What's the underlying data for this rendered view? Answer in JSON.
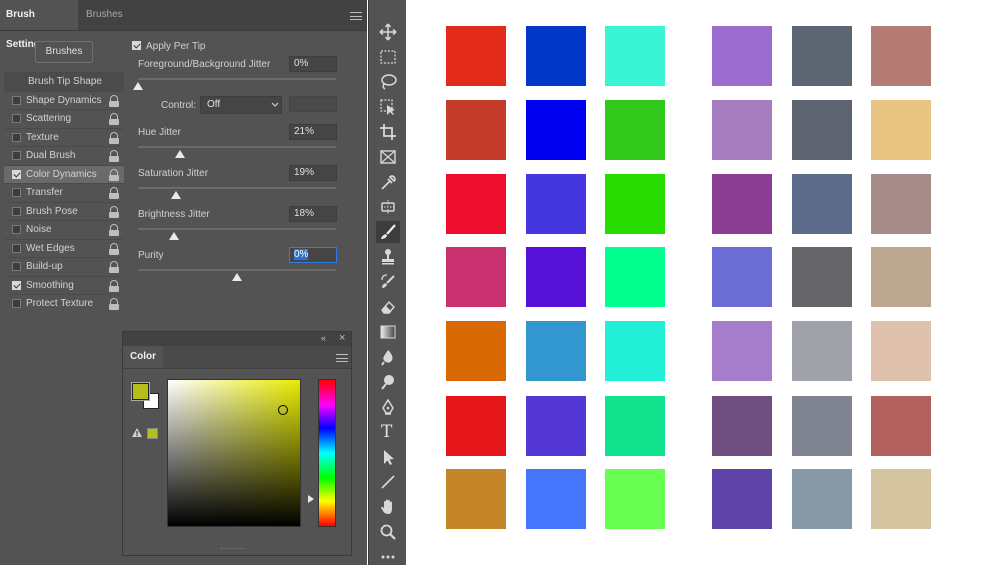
{
  "brush_settings": {
    "tabs": [
      "Brush Settings",
      "Brushes"
    ],
    "brushes_button": "Brushes",
    "options": [
      {
        "label": "Brush Tip Shape",
        "header": true
      },
      {
        "label": "Shape Dynamics",
        "checked": false
      },
      {
        "label": "Scattering",
        "checked": false
      },
      {
        "label": "Texture",
        "checked": false
      },
      {
        "label": "Dual Brush",
        "checked": false
      },
      {
        "label": "Color Dynamics",
        "checked": true,
        "selected": true
      },
      {
        "label": "Transfer",
        "checked": false
      },
      {
        "label": "Brush Pose",
        "checked": false
      },
      {
        "label": "Noise",
        "checked": false
      },
      {
        "label": "Wet Edges",
        "checked": false
      },
      {
        "label": "Build-up",
        "checked": false
      },
      {
        "label": "Smoothing",
        "checked": true
      },
      {
        "label": "Protect Texture",
        "checked": false
      }
    ],
    "apply_per_tip": {
      "label": "Apply Per Tip",
      "checked": true
    },
    "fg_bg_jitter": {
      "label": "Foreground/Background Jitter",
      "value": "0%",
      "level": 0
    },
    "control": {
      "label": "Control:",
      "value": "Off"
    },
    "hue_jitter": {
      "label": "Hue Jitter",
      "value": "21%",
      "level": 0.21
    },
    "saturation_jitter": {
      "label": "Saturation Jitter",
      "value": "19%",
      "level": 0.19
    },
    "brightness_jitter": {
      "label": "Brightness Jitter",
      "value": "18%",
      "level": 0.18
    },
    "purity": {
      "label": "Purity",
      "value": "0%",
      "level": 0.5
    }
  },
  "color_panel": {
    "tab_label": "Color",
    "foreground": "#b5bf1c",
    "background": "#ffffff",
    "hue_color": "#e8ec00"
  },
  "toolbar": {
    "tools": [
      "move-tool-icon",
      "marquee-tool-icon",
      "lasso-tool-icon",
      "object-select-tool-icon",
      "crop-tool-icon",
      "frame-tool-icon",
      "eyedropper-tool-icon",
      "healing-brush-tool-icon",
      "brush-tool-icon",
      "clone-stamp-tool-icon",
      "history-brush-tool-icon",
      "eraser-tool-icon",
      "gradient-tool-icon",
      "blur-tool-icon",
      "dodge-tool-icon",
      "pen-tool-icon",
      "type-tool-icon",
      "path-selection-tool-icon",
      "line-tool-icon",
      "hand-tool-icon",
      "zoom-tool-icon",
      "more-tools-icon"
    ],
    "active_tool": "brush-tool-icon",
    "type_glyph": "T"
  },
  "swatches": {
    "left_group": [
      [
        "#e32b1b",
        "#0037c8",
        "#39f5d3"
      ],
      [
        "#c43b2b",
        "#0000f0",
        "#2fc81b"
      ],
      [
        "#f00e30",
        "#4437e0",
        "#28dc00"
      ],
      [
        "#c8306e",
        "#5512d6",
        "#00ff8f"
      ],
      [
        "#d86905",
        "#3397d0",
        "#22f0d6"
      ],
      [
        "#e4161a",
        "#5438d6",
        "#12e38f"
      ],
      [
        "#c5862a",
        "#4476fb",
        "#66ff52"
      ]
    ],
    "right_group": [
      [
        "#9b6bcf",
        "#5c6673",
        "#b57c75"
      ],
      [
        "#a67dbf",
        "#5d6470",
        "#e8c582"
      ],
      [
        "#8a3d92",
        "#5b6b89",
        "#a58c88"
      ],
      [
        "#6c6cd5",
        "#656569",
        "#bca890"
      ],
      [
        "#a57dca",
        "#9fa2a8",
        "#e0c1ad"
      ],
      [
        "#6e4f80",
        "#7f8490",
        "#b1605c"
      ],
      [
        "#5e44a8",
        "#8799a6",
        "#d4c4a0"
      ]
    ]
  }
}
